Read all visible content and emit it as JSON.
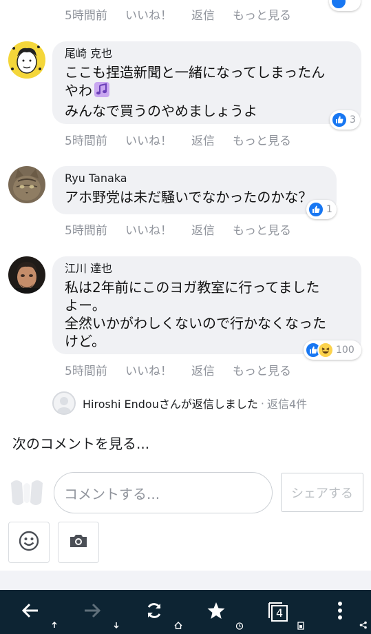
{
  "actions": {
    "time": "5時間前",
    "like": "いいね！",
    "reply": "返信",
    "more": "もっと見る"
  },
  "comments": [
    {
      "author": "尾崎 克也",
      "lines": [
        "ここも捏造新聞と一緒になってしまったん",
        "やわ",
        "みんなで買うのやめましょうよ"
      ],
      "reactions": [
        "like-icon"
      ],
      "reaction_count": "3"
    },
    {
      "author": "Ryu Tanaka",
      "lines": [
        "アホ野党は未だ騒いでなかったのかな？"
      ],
      "reactions": [
        "like-icon"
      ],
      "reaction_count": "1"
    },
    {
      "author": "江川 達也",
      "lines": [
        "私は2年前にこのヨガ教室に行ってました",
        "よー。",
        "全然いかがわしくないので行かなくなった",
        "けど。"
      ],
      "reactions": [
        "like-icon",
        "haha-icon"
      ],
      "reaction_count": "100"
    }
  ],
  "reply_summary": {
    "text": "Hiroshi Endouさんが返信しました",
    "separator": "·",
    "count": "返信4件"
  },
  "next_comments_link": "次のコメントを見る...",
  "composer": {
    "placeholder": "コメントする...",
    "share_label": "シェアする"
  },
  "tab_count": "4",
  "colors": {
    "like_blue": "#1877f2",
    "navbar_bg": "#0d2433",
    "meta_gray": "#90949c",
    "bubble_bg": "#f0f1f4"
  }
}
